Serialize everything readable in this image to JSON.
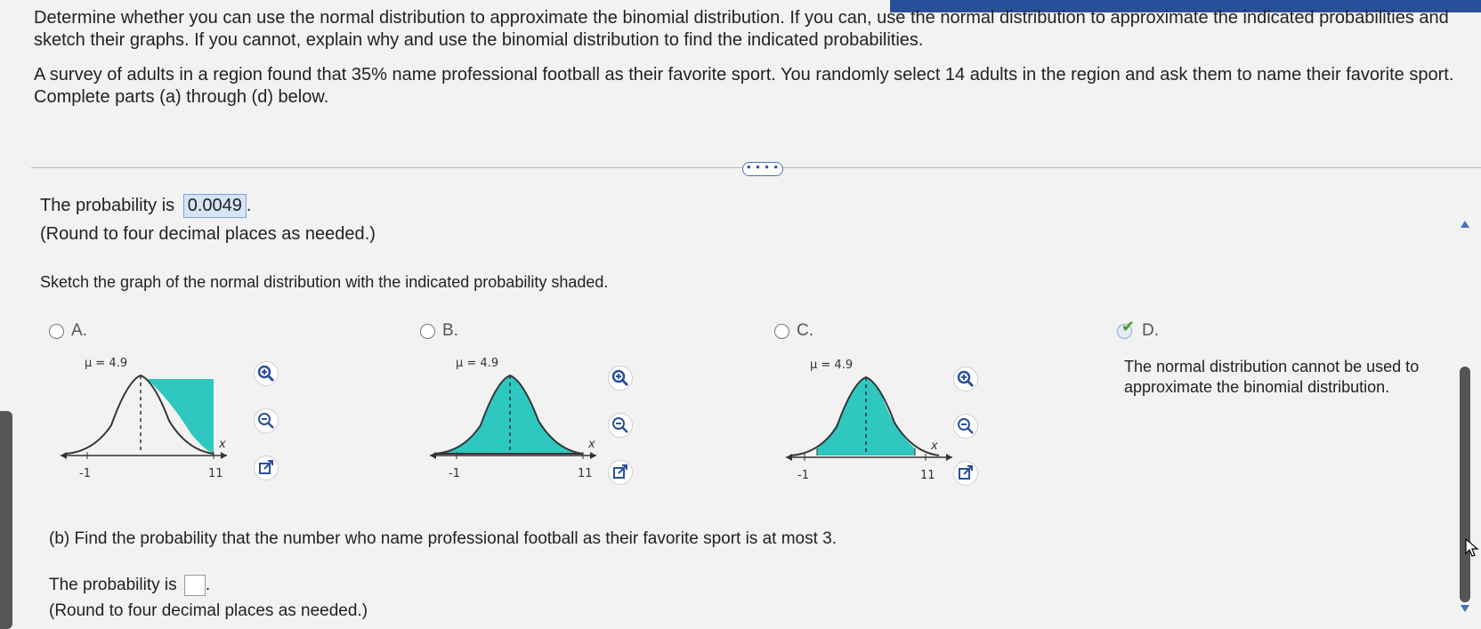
{
  "instructions": {
    "para1": "Determine whether you can use the normal distribution to approximate the binomial distribution. If you can, use the normal distribution to approximate the indicated probabilities and sketch their graphs. If you cannot, explain why and use the binomial distribution to find the indicated probabilities.",
    "para2": "A survey of adults in a region found that 35% name professional football as their favorite sport. You randomly select 14 adults in the region and ask them to name their favorite sport. Complete parts (a) through (d) below."
  },
  "more_button": "• • • •",
  "part_a": {
    "prob_prefix": "The probability is",
    "prob_value": "0.0049",
    "prob_suffix": ".",
    "round_note": "(Round to four decimal places as needed.)",
    "sketch_prompt": "Sketch the graph of the normal distribution with the indicated probability shaded."
  },
  "options": [
    {
      "letter": "A.",
      "mu_label": "μ = 4.9",
      "x_min": "-1",
      "x_max": "11",
      "x_axis": "x",
      "selected": false
    },
    {
      "letter": "B.",
      "mu_label": "μ = 4.9",
      "x_min": "-1",
      "x_max": "11",
      "x_axis": "x",
      "selected": false
    },
    {
      "letter": "C.",
      "mu_label": "μ = 4.9",
      "x_min": "-1",
      "x_max": "11",
      "x_axis": "x",
      "selected": false
    },
    {
      "letter": "D.",
      "text": "The normal distribution cannot be used to approximate the binomial distribution.",
      "selected": true
    }
  ],
  "part_b": {
    "question": "(b) Find the probability that the number who name professional football as their favorite sport is at most 3.",
    "prob_prefix": "The probability is",
    "prob_suffix": ".",
    "round_note": "(Round to four decimal places as needed.)"
  },
  "icons": [
    "zoom-in-icon",
    "zoom-out-icon",
    "popout-icon"
  ],
  "colors": {
    "accent": "#2a4f9a",
    "fill": "#2ec8c0",
    "highlight": "#d6e4f5"
  }
}
